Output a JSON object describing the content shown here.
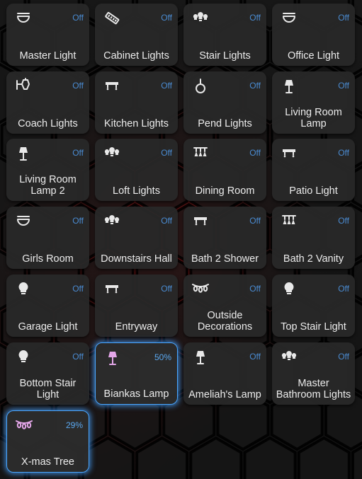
{
  "theme": {
    "icon_color": "#e8e8e8",
    "icon_on_color": "#e3a6e8",
    "state_color": "#4a8bd1",
    "glow_color": "#4aa6ff"
  },
  "tiles": [
    {
      "name": "Master Light",
      "state": "Off",
      "icon": "ceiling-light-icon",
      "on": false
    },
    {
      "name": "Cabinet Lights",
      "state": "Off",
      "icon": "led-strip-icon",
      "on": false
    },
    {
      "name": "Stair Lights",
      "state": "Off",
      "icon": "lightbulb-group-icon",
      "on": false
    },
    {
      "name": "Office Light",
      "state": "Off",
      "icon": "ceiling-light-icon",
      "on": false
    },
    {
      "name": "Coach Lights",
      "state": "Off",
      "icon": "coach-lamp-icon",
      "on": false
    },
    {
      "name": "Kitchen Lights",
      "state": "Off",
      "icon": "track-light-icon",
      "on": false
    },
    {
      "name": "Pend Lights",
      "state": "Off",
      "icon": "pendant-light-icon",
      "on": false
    },
    {
      "name": "Living Room Lamp",
      "state": "Off",
      "icon": "floor-lamp-icon",
      "on": false
    },
    {
      "name": "Living Room Lamp 2",
      "state": "Off",
      "icon": "floor-lamp-icon",
      "on": false
    },
    {
      "name": "Loft Lights",
      "state": "Off",
      "icon": "lightbulb-group-icon",
      "on": false
    },
    {
      "name": "Dining Room",
      "state": "Off",
      "icon": "chandelier-icon",
      "on": false
    },
    {
      "name": "Patio Light",
      "state": "Off",
      "icon": "track-light-icon",
      "on": false
    },
    {
      "name": "Girls Room",
      "state": "Off",
      "icon": "ceiling-light-icon",
      "on": false
    },
    {
      "name": "Downstairs Hall",
      "state": "Off",
      "icon": "lightbulb-group-icon",
      "on": false
    },
    {
      "name": "Bath 2 Shower",
      "state": "Off",
      "icon": "track-light-icon",
      "on": false
    },
    {
      "name": "Bath 2 Vanity",
      "state": "Off",
      "icon": "chandelier-icon",
      "on": false
    },
    {
      "name": "Garage Light",
      "state": "Off",
      "icon": "lightbulb-icon",
      "on": false
    },
    {
      "name": "Entryway",
      "state": "Off",
      "icon": "track-light-icon",
      "on": false
    },
    {
      "name": "Outside Decorations",
      "state": "Off",
      "icon": "string-lights-icon",
      "on": false
    },
    {
      "name": "Top Stair Light",
      "state": "Off",
      "icon": "lightbulb-icon",
      "on": false
    },
    {
      "name": "Bottom Stair Light",
      "state": "Off",
      "icon": "lightbulb-icon",
      "on": false
    },
    {
      "name": "Biankas Lamp",
      "state": "50%",
      "icon": "floor-lamp-icon",
      "on": true,
      "brightness": 50
    },
    {
      "name": "Ameliah's Lamp",
      "state": "Off",
      "icon": "floor-lamp-icon",
      "on": false
    },
    {
      "name": "Master Bathroom Lights",
      "state": "Off",
      "icon": "lightbulb-group-icon",
      "on": false
    },
    {
      "name": "X-mas Tree",
      "state": "29%",
      "icon": "string-lights-icon",
      "on": true,
      "brightness": 29
    }
  ]
}
